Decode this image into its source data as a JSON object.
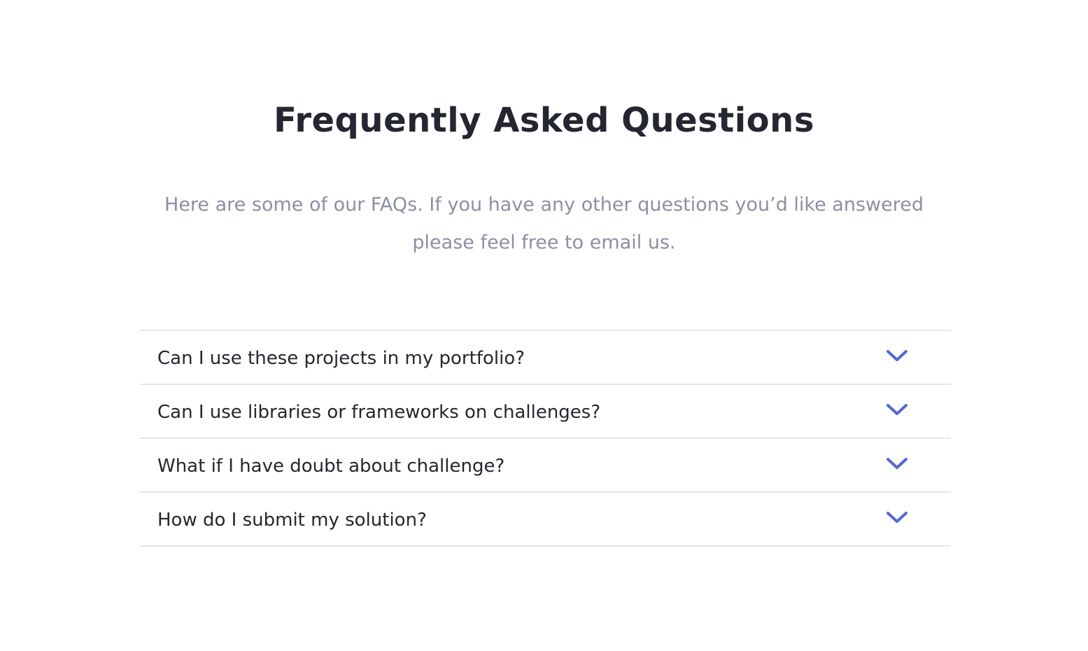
{
  "header": {
    "title": "Frequently Asked Questions",
    "subtitle": "Here are some of our FAQs. If you have any other questions you’d like answered please feel free to email us."
  },
  "faq": {
    "items": [
      {
        "question": "Can I use these projects in my portfolio?",
        "icon": "chevron-down-icon"
      },
      {
        "question": "Can I use libraries or frameworks on challenges?",
        "icon": "chevron-down-icon"
      },
      {
        "question": "What if I have doubt about challenge?",
        "icon": "chevron-down-icon"
      },
      {
        "question": "How do I submit my solution?",
        "icon": "chevron-down-icon"
      }
    ]
  },
  "colors": {
    "accent": "#5267df",
    "heading": "#242731",
    "muted": "#8c8fa6",
    "divider": "#e6e6e6"
  }
}
